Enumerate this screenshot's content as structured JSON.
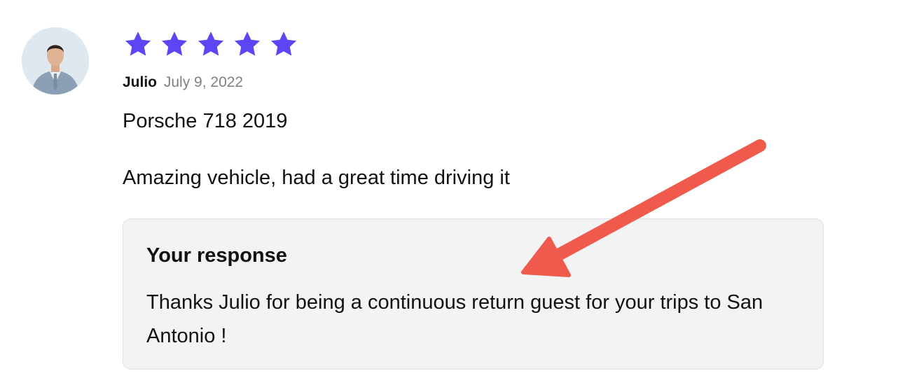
{
  "review": {
    "avatar_icon": "user-avatar-photo",
    "rating": 5,
    "rating_max": 5,
    "star_color": "#5b45f5",
    "reviewer_name": "Julio",
    "date": "July 9, 2022",
    "vehicle": "Porsche 718 2019",
    "text": "Amazing vehicle, had a great time driving it"
  },
  "response": {
    "title": "Your response",
    "text": "Thanks Julio for being a continuous return guest for your trips to San Antonio !"
  },
  "annotation": {
    "arrow_icon": "red-arrow-icon",
    "color": "#ef5a4c"
  }
}
